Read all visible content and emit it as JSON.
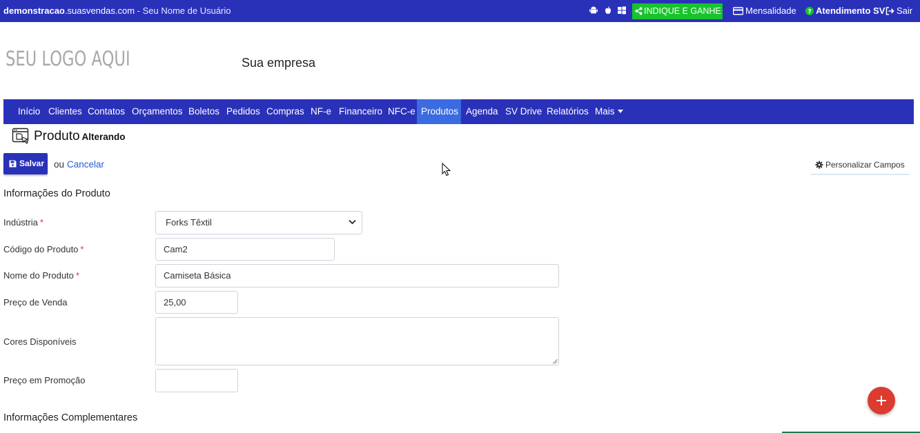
{
  "topbar": {
    "domain_bold": "demonstracao",
    "domain_rest": ".suasvendas.com",
    "separator": " - ",
    "user": "Seu Nome de Usuário",
    "platform_icons": [
      "android-icon",
      "apple-icon",
      "windows-icon"
    ],
    "indique_label": "INDIQUE E GANHE",
    "mensalidade_label": "Mensalidade",
    "atendimento_label": "Atendimento SV",
    "sair_label": "Sair",
    "colors": {
      "bar": "#2a31b9",
      "indique": "#17c42b"
    }
  },
  "brand": {
    "logo_text": "SEU LOGO AQUI",
    "company": "Sua empresa"
  },
  "nav": {
    "items": [
      "Início",
      "Clientes",
      "Contatos",
      "Orçamentos",
      "Boletos",
      "Pedidos",
      "Compras",
      "NF-e",
      "Financeiro",
      "NFC-e",
      "Produtos",
      "Agenda",
      "SV Drive",
      "Relatórios",
      "Mais"
    ],
    "active": "Produtos",
    "active_color": "#3b6be0"
  },
  "page": {
    "title": "Produto",
    "subtitle": "Alterando",
    "save_label": "Salvar",
    "or_text": "ou",
    "cancel_label": "Cancelar",
    "personalizar_label": "Personalizar Campos"
  },
  "form": {
    "section1": "Informações do Produto",
    "industria_label": "Indústria",
    "industria_value": "Forks Têxtil",
    "codigo_label": "Código do Produto",
    "codigo_value": "Cam2",
    "nome_label": "Nome do Produto",
    "nome_value": "Camiseta Básica",
    "preco_label": "Preço de Venda",
    "preco_value": "25,00",
    "cores_label": "Cores Disponíveis",
    "cores_value": "",
    "promo_label": "Preço em Promoção",
    "promo_value": "",
    "required_mark": "*",
    "section2": "Informações Complementares"
  },
  "fab": {
    "icon": "plus-icon",
    "color": "#dc3b2f"
  }
}
